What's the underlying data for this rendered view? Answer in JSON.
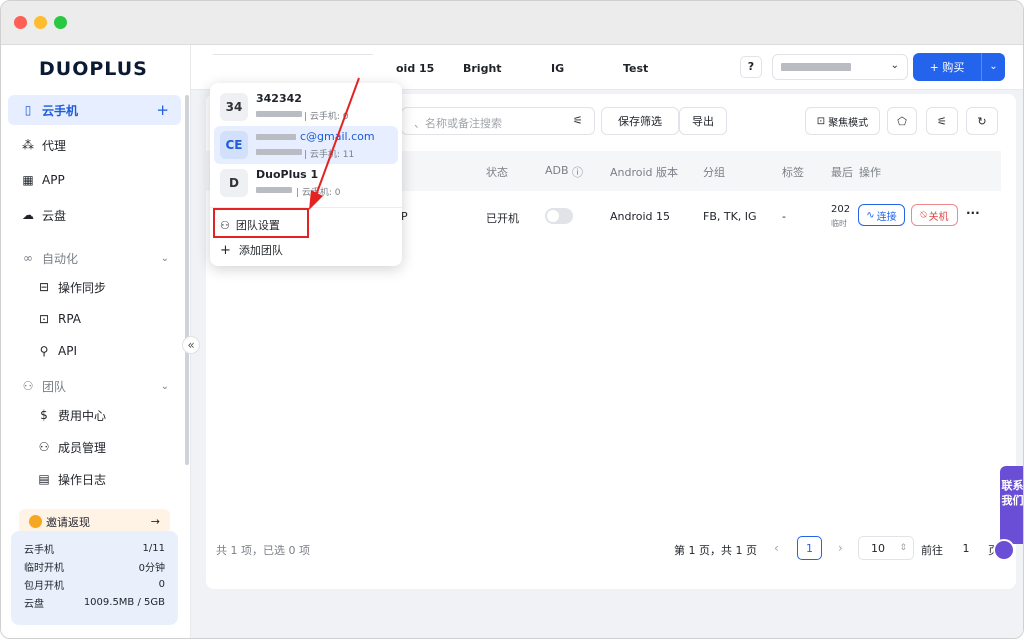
{
  "app": {
    "brand": "DUOPLUS"
  },
  "sidebar": {
    "items": [
      {
        "label": "云手机",
        "icon": "phone-icon"
      },
      {
        "label": "代理",
        "icon": "proxy-icon"
      },
      {
        "label": "APP",
        "icon": "grid-icon"
      },
      {
        "label": "云盘",
        "icon": "cloud-icon"
      }
    ],
    "automation": {
      "label": "自动化",
      "items": [
        "操作同步",
        "RPA",
        "API"
      ]
    },
    "team": {
      "label": "团队",
      "items": [
        "费用中心",
        "成员管理",
        "操作日志"
      ]
    },
    "invite": "邀请返现",
    "invite_arrow": "→",
    "stats": [
      {
        "label": "云手机",
        "value": "1/11"
      },
      {
        "label": "临时开机",
        "value": "0分钟"
      },
      {
        "label": "包月开机",
        "value": "0"
      },
      {
        "label": "云盘",
        "value": "1009.5MB / 5GB"
      }
    ]
  },
  "topbar": {
    "team_prefix": "CE",
    "help": "?",
    "buy_label": "+ 购买"
  },
  "tabs": [
    "oid 15",
    "Bright",
    "IG",
    "Test"
  ],
  "toolbar": {
    "search_placeholder": "、名称或备注搜索",
    "save_filter": "保存筛选",
    "export": "导出",
    "focus_mode": "聚焦模式"
  },
  "table": {
    "headers": [
      "状态",
      "ADB",
      "Android 版本",
      "分组",
      "标签",
      "最后",
      "操作"
    ],
    "row": {
      "name_tail": "P",
      "status": "已开机",
      "android": "Android 15",
      "group": "FB, TK, IG",
      "tag": "-",
      "last_top": "202",
      "last_bottom": "临时",
      "connect": "连接",
      "shutdown": "关机",
      "more": "···"
    }
  },
  "footer": {
    "summary": "共 1 项，已选 0 项",
    "page_info": "第 1 页，共 1 页",
    "current_page": "1",
    "page_size": "10",
    "goto_label": "前往",
    "goto_value": "1",
    "page_unit": "页"
  },
  "dropdown": {
    "teams": [
      {
        "badge": "34",
        "name": "342342",
        "sub": "| 云手机: 0"
      },
      {
        "badge": "CE",
        "name": "c@gmail.com",
        "sub": "| 云手机: 11"
      },
      {
        "badge": "D",
        "name": "DuoPlus 1",
        "sub": "| 云手机: 0"
      }
    ],
    "team_settings": "团队设置",
    "add_team": "添加团队"
  },
  "contact": "联系我们",
  "colors": {
    "accent": "#2463eb",
    "highlight_box": "#e52222",
    "contact": "#6a4fd6"
  }
}
